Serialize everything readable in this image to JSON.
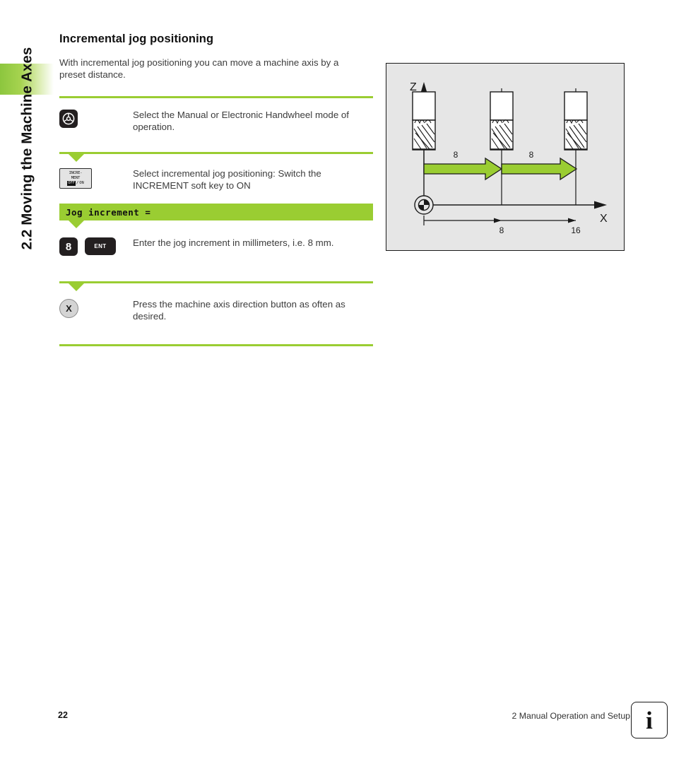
{
  "sidebar": {
    "chapter_label": "2.2 Moving the Machine Axes",
    "accent_color": "#8cc63e"
  },
  "page": {
    "heading": "Incremental jog positioning",
    "intro": "With incremental jog positioning you can move a machine axis by a preset distance."
  },
  "steps": [
    {
      "key_icon": "handwheel-icon",
      "text": "Select the Manual or Electronic Handwheel mode of operation."
    },
    {
      "key_icon": "increment-softkey",
      "softkey": {
        "line1": "INCRE-",
        "line2": "MENT",
        "state_off": "OFF",
        "state_sep": "/",
        "state_on": "ON"
      },
      "text": "Select incremental jog positioning: Switch the INCREMENT soft key to ON"
    },
    {
      "key_digit": "8",
      "key_enter": "ENT",
      "text": "Enter the jog increment in millimeters, i.e. 8 mm."
    },
    {
      "key_axis": "X",
      "text": "Press the machine axis direction button as often as desired."
    }
  ],
  "prompt": {
    "label": "Jog increment ="
  },
  "figure": {
    "axis_z_label": "Z",
    "axis_x_label": "X",
    "increment_label_1": "8",
    "increment_label_2": "8",
    "absolute_label_1": "8",
    "absolute_label_2": "16",
    "arrow_color": "#9acd32",
    "background_color": "#e6e6e6"
  },
  "footer": {
    "page_number": "22",
    "chapter": "2 Manual Operation and Setup",
    "info_glyph": "i"
  }
}
